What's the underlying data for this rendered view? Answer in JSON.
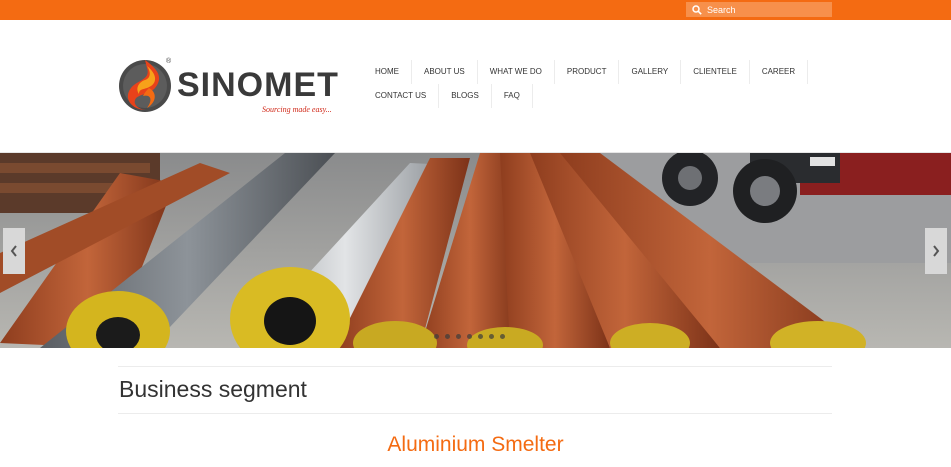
{
  "search": {
    "placeholder": "Search"
  },
  "logo": {
    "name": "SINOMET",
    "tagline": "Sourcing made easy...",
    "registered": "®"
  },
  "nav": {
    "row1": [
      "HOME",
      "ABOUT US",
      "WHAT WE DO",
      "PRODUCT",
      "GALLERY",
      "CLIENTELE",
      "CAREER"
    ],
    "row2": [
      "CONTACT US",
      "BLOGS",
      "FAQ"
    ]
  },
  "slider": {
    "slide_count": 7
  },
  "section": {
    "title": "Business segment",
    "segment": "Aluminium Smelter"
  },
  "colors": {
    "accent": "#f46b12",
    "text": "#333333"
  },
  "icons": {
    "search": "search-icon",
    "prev": "chevron-left-icon",
    "next": "chevron-right-icon"
  }
}
